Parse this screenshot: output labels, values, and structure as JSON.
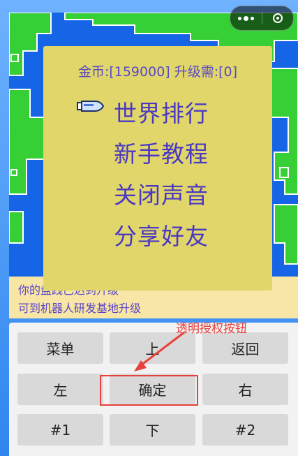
{
  "capsule": {
    "more_icon": "more-dots-icon",
    "close_icon": "circle-dot-icon"
  },
  "menu": {
    "coins_text": "金币:[159000] 升级需:[0]",
    "pointer_icon": "hand-pointer-icon",
    "items": [
      {
        "label": "世界排行",
        "selected": true
      },
      {
        "label": "新手教程"
      },
      {
        "label": "关闭声音"
      },
      {
        "label": "分享好友"
      }
    ]
  },
  "message": {
    "line1": "你的盘践已达到升级",
    "line2": "可到机器人研发基地升级"
  },
  "controls": {
    "menu": "菜单",
    "up": "上",
    "back": "返回",
    "left": "左",
    "confirm": "确定",
    "right": "右",
    "f1": "#1",
    "down": "下",
    "f2": "#2"
  },
  "annotation": {
    "label": "透明授权按钮",
    "color": "#e8403a"
  },
  "colors": {
    "sea": "#1565e6",
    "land": "#2ecc2e",
    "panel": "#e0d66a",
    "menu_text": "#4b38c2"
  }
}
